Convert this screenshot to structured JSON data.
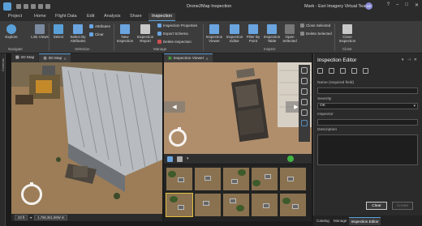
{
  "app": {
    "title": "Drone2Map Inspection",
    "user": "Mark - Esri Imagery Virtual Team",
    "avatar_initials": "ME",
    "window_buttons": [
      "?",
      "–",
      "□",
      "✕"
    ]
  },
  "tabs": [
    "Project",
    "Home",
    "Flight Data",
    "Edit",
    "Analysis",
    "Share",
    "Inspection"
  ],
  "active_tab": "Inspection",
  "ribbon": {
    "navigate": {
      "explore_label": "Explore",
      "group_label": "Navigate"
    },
    "selection": {
      "select_label": "Select",
      "select_by_attributes_label": "Select By Attributes",
      "attributes_label": "Attributes",
      "clear_label": "Clear",
      "link_views_label": "Link Views",
      "group_label": "Selection"
    },
    "manage": {
      "new_inspection_label": "New Inspection",
      "inspection_report_label": "Inspection Report",
      "inspection_properties_label": "Inspection Properties",
      "export_schema_label": "Export Schema",
      "delete_inspection_label": "Delete Inspection",
      "group_label": "Manage"
    },
    "inspect": {
      "inspection_viewer_label": "Inspection Viewer",
      "inspection_editor_label": "Inspection Editor",
      "filter_by_point_label": "Filter By Point",
      "inspection_table_label": "Inspection Table",
      "open_selected_label": "Open Selected",
      "close_selected_label": "Close Selected",
      "delete_selected_label": "Delete Selected",
      "group_label": "Inspect"
    },
    "close": {
      "close_inspection_label": "Close Inspection",
      "group_label": "Close"
    }
  },
  "left_strip_label": "Contents",
  "map_tabs": [
    {
      "label": "2D Map",
      "active": false
    },
    {
      "label": "3D Map",
      "active": true
    }
  ],
  "viewer_tab": "Inspection Viewer",
  "map_status": {
    "scale": "33 ft",
    "coordinates": "1,768,361.88W m"
  },
  "inspection_editor": {
    "title": "Inspection Editor",
    "name_label": "Name (required field)",
    "name_value": "",
    "severity_label": "Severity",
    "severity_value": "OK",
    "inspector_label": "Inspector",
    "inspector_value": "",
    "description_label": "Description",
    "description_value": "",
    "clear_button": "Clear",
    "create_button": "Create"
  },
  "panel_tabs": [
    "Catalog",
    "Manage",
    "Inspection Editor"
  ],
  "active_panel_tab": "Inspection Editor",
  "colors": {
    "accent": "#5aa0d8",
    "ok_check": "#43b343",
    "selected_thumb": "#e0c040"
  }
}
